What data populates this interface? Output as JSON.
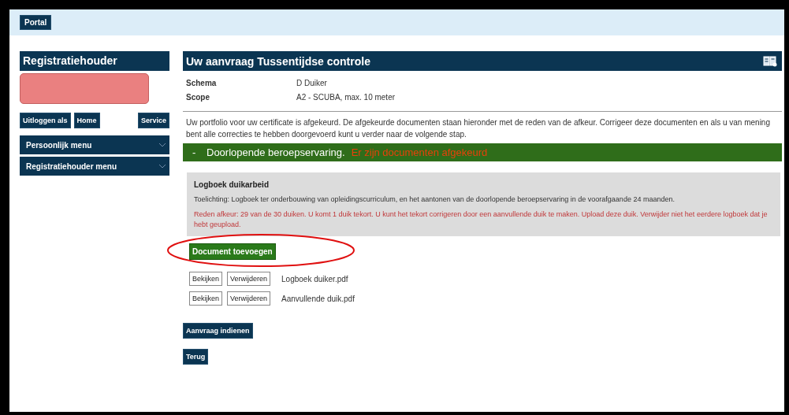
{
  "top_bar": {
    "portal_button": "Portal"
  },
  "sidebar": {
    "title": "Registratiehouder",
    "buttons": [
      "Uitloggen als",
      "Home",
      "Service"
    ],
    "menus": [
      {
        "label": "Persoonlijk menu",
        "expanded": false
      },
      {
        "label": "Registratiehouder menu",
        "expanded": false
      }
    ]
  },
  "main": {
    "title": "Uw aanvraag Tussentijdse controle",
    "details": [
      {
        "label": "Schema",
        "value": "D Duiker"
      },
      {
        "label": "Scope",
        "value": "A2 - SCUBA, max. 10 meter"
      }
    ],
    "intro": "Uw portfolio voor uw certificate is afgekeurd. De afgekeurde documenten staan hieronder met de reden van de afkeur. Corrigeer deze documenten en als u van mening bent alle correcties te hebben doorgevoerd kunt u verder naar de volgende stap.",
    "section": {
      "toggle": "-",
      "title": "Doorlopende beroepservaring.",
      "warning": "Er zijn documenten afgekeurd",
      "expanded": true,
      "document": {
        "title": "Logboek duikarbeid",
        "explanation": "Toelichting: Logboek ter onderbouwing van opleidingscurriculum, en het aantonen van de doorlopende beroepservaring in de voorafgaande 24 maanden.",
        "rejection": "Reden afkeur: 29 van de 30 duiken. U komt 1 duik tekort. U kunt het tekort corrigeren door een aanvullende duik te maken. Upload deze duik. Verwijder niet het eerdere logboek dat je hebt geupload."
      },
      "add_button": "Document toevoegen",
      "files": [
        {
          "view": "Bekijken",
          "delete": "Verwijderen",
          "name": "Logboek duiker.pdf"
        },
        {
          "view": "Bekijken",
          "delete": "Verwijderen",
          "name": "Aanvullende duik.pdf"
        }
      ]
    },
    "submit_button": "Aanvraag indienen",
    "back_button": "Terug"
  }
}
